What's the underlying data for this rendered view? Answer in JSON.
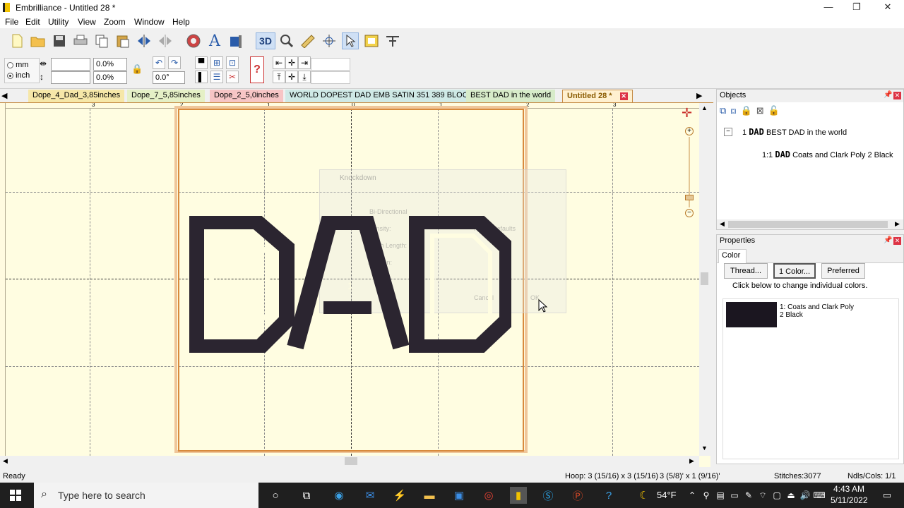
{
  "window": {
    "title": "Embrilliance - Untitled 28 *",
    "minimize": "—",
    "maximize": "❐",
    "close": "✕"
  },
  "menu": [
    "File",
    "Edit",
    "Utility",
    "View",
    "Zoom",
    "Window",
    "Help"
  ],
  "toolbar": {
    "view3d_label": "3D"
  },
  "units": {
    "mm": "mm",
    "inch": "inch"
  },
  "fields": {
    "width_pct": "0.0%",
    "height_pct": "0.0%",
    "rotation": "0.0°"
  },
  "tabs": [
    {
      "label": "Dope_4_Dad_3,85inches",
      "color": "#f6e7a8"
    },
    {
      "label": "Dope_7_5,85inches",
      "color": "#e5f0c6"
    },
    {
      "label": "Dope_2_5,0inches",
      "color": "#f7c5c5"
    },
    {
      "label": "WORLD DOPEST DAD EMB SATIN 351 389 BLOCK",
      "color": "#cfe9e6"
    },
    {
      "label": "BEST DAD in the world",
      "color": "#d7ebc9"
    },
    {
      "label": "Untitled 28 *",
      "color": "#fff0d0"
    }
  ],
  "canvas": {
    "ruler_labels": [
      "3",
      "2",
      "1",
      "0",
      "1",
      "2",
      "3"
    ],
    "design_text": "DAD",
    "ghost_dialog": {
      "title": "Knockdown",
      "checkbox": "Bi-Directional",
      "density": "Density:",
      "stitch_length": "Stitch Length:",
      "inflation": "Inflation:",
      "reset": "Reset Defaults",
      "cancel": "Cancel",
      "ok": "OK"
    }
  },
  "objects_panel": {
    "title": "Objects",
    "items": [
      {
        "index": "1",
        "name": "BEST DAD in the world"
      },
      {
        "index": "1:1",
        "name": "Coats and Clark Poly 2 Black"
      }
    ],
    "logo_text": "DAD"
  },
  "properties_panel": {
    "title": "Properties",
    "tab": "Color",
    "buttons": {
      "thread": "Thread...",
      "one_color": "1 Color...",
      "preferred": "Preferred"
    },
    "hint": "Click below to change individual colors.",
    "swatch": {
      "color": "#1b1620",
      "label": "1: Coats and Clark Poly 2 Black"
    }
  },
  "status": {
    "ready": "Ready",
    "hoop": "Hoop: 3 (15/16) x 3 (15/16)",
    "size": "3 (5/8)' x 1 (9/16)'",
    "stitches": "Stitches:3077",
    "needles": "Ndls/Cols: 1/1"
  },
  "taskbar": {
    "search_placeholder": "Type here to search",
    "weather": "54°F",
    "time": "4:43 AM",
    "date": "5/11/2022"
  },
  "colors": {
    "design": "#2b2530",
    "canvas": "#fffde1",
    "hoop": "#d88a3c",
    "ruler_label": "#5a5a5a"
  }
}
